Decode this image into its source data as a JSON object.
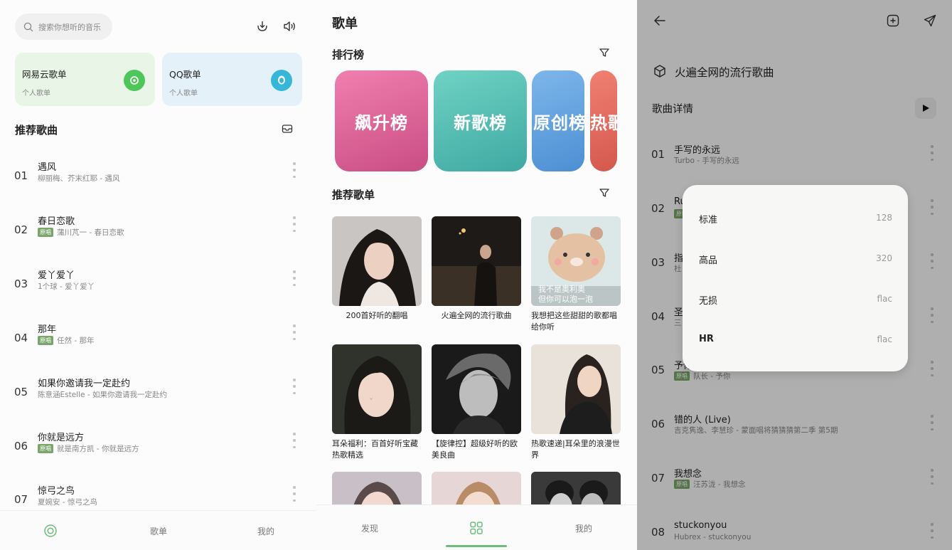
{
  "panel1": {
    "search_placeholder": "搜索你想听的音乐",
    "cards": [
      {
        "title": "网易云歌单",
        "sub": "个人歌单",
        "color": "#e9f6e7",
        "logo_color": "#4dc65a"
      },
      {
        "title": "QQ歌单",
        "sub": "个人歌单",
        "color": "#e4f1f9",
        "logo_color": "#36b6d9"
      }
    ],
    "section_title": "推荐歌曲",
    "songs": [
      {
        "num": "01",
        "name": "遇风",
        "tag": "",
        "sub": "柳丽梅、芥末红耶 - 遇风"
      },
      {
        "num": "02",
        "name": "春日恋歌",
        "tag": "原唱",
        "sub": "蒲川芃一 - 春日恋歌"
      },
      {
        "num": "03",
        "name": "爱丫爱丫",
        "tag": "",
        "sub": "1个球 - 爱丫爱丫"
      },
      {
        "num": "04",
        "name": "那年",
        "tag": "原唱",
        "sub": "任然 - 那年"
      },
      {
        "num": "05",
        "name": "如果你邀请我一定赴约",
        "tag": "",
        "sub": "陈意涵Estelle - 如果你邀请我一定赴约"
      },
      {
        "num": "06",
        "name": "你就是远方",
        "tag": "原唱",
        "sub": "就是南方凯 - 你就是远方"
      },
      {
        "num": "07",
        "name": "惊弓之鸟",
        "tag": "",
        "sub": "夏婉安 - 惊弓之鸟"
      }
    ],
    "nav": [
      "歌单",
      "我的"
    ]
  },
  "panel2": {
    "title": "歌单",
    "rank_title": "排行榜",
    "ranks": [
      {
        "label": "飙升榜",
        "c1": "#f07fae",
        "c2": "#c94d83"
      },
      {
        "label": "新歌榜",
        "c1": "#6fd2c4",
        "c2": "#3fa9a2"
      },
      {
        "label": "原创榜",
        "c1": "#7db6ea",
        "c2": "#4d8fd4"
      },
      {
        "label": "热歌",
        "c1": "#f08072",
        "c2": "#d4584d"
      }
    ],
    "rec_title": "推荐歌单",
    "playlists": [
      {
        "cap": "200首好听的翻唱"
      },
      {
        "cap": "火遍全网的流行歌曲"
      },
      {
        "cap": "我想把这些甜甜的歌都唱给你听",
        "overlay": "我不是奥利奥\n但你可以泡一泡"
      },
      {
        "cap": "耳朵福利：百首好听宝藏热歌精选"
      },
      {
        "cap": "【旋律控】超级好听的欧美良曲"
      },
      {
        "cap": "热歌速递|耳朵里的浪漫世界"
      }
    ],
    "nav": [
      "发现",
      "我的"
    ]
  },
  "panel3": {
    "playlist_title": "火遍全网的流行歌曲",
    "detail_title": "歌曲详情",
    "songs": [
      {
        "num": "01",
        "name": "手写的永远",
        "tag": "",
        "sub": "Turbo - 手写的永远"
      },
      {
        "num": "02",
        "name": "Ru",
        "tag": "原唱",
        "sub": ""
      },
      {
        "num": "03",
        "name": "指",
        "tag": "",
        "sub": "杜"
      },
      {
        "num": "04",
        "name": "圣",
        "tag": "",
        "sub": "三"
      },
      {
        "num": "05",
        "name": "予你",
        "tag": "原唱",
        "sub": "队长 - 予你"
      },
      {
        "num": "06",
        "name": "错的人 (Live)",
        "tag": "",
        "sub": "吉克隽逸、李慧珍 - 蒙面唱将猜猜猜第二季 第5期"
      },
      {
        "num": "07",
        "name": "我想念",
        "tag": "原唱",
        "sub": "汪苏泷 - 我想念"
      },
      {
        "num": "08",
        "name": "stuckonyou",
        "tag": "",
        "sub": "Hubrex - stuckonyou"
      }
    ],
    "quality": [
      {
        "label": "标准",
        "value": "128"
      },
      {
        "label": "高品",
        "value": "320"
      },
      {
        "label": "无损",
        "value": "flac"
      },
      {
        "label": "HR",
        "value": "flac"
      }
    ]
  }
}
